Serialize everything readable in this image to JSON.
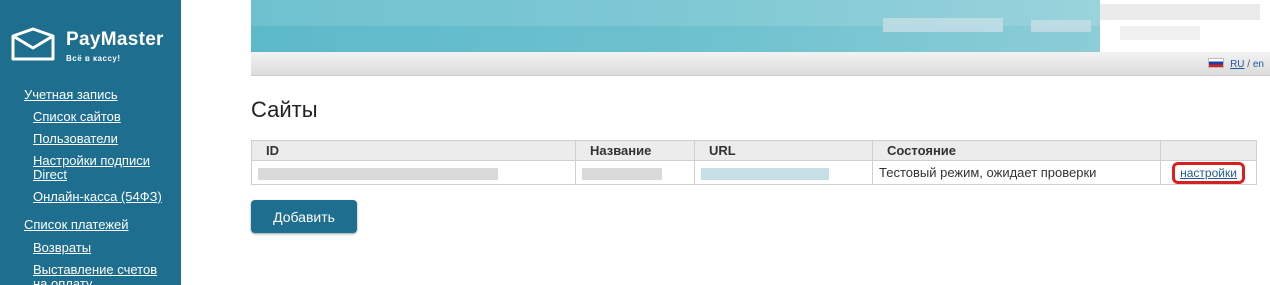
{
  "brand": {
    "title": "PayMaster",
    "tagline": "Всё в кассу!"
  },
  "sidebar": {
    "items": [
      {
        "label": "Учетная запись",
        "level": "top"
      },
      {
        "label": "Список сайтов",
        "level": "sub"
      },
      {
        "label": "Пользователи",
        "level": "sub"
      },
      {
        "label": "Настройки подписи Direct",
        "level": "sub"
      },
      {
        "label": "Онлайн-касса (54ФЗ)",
        "level": "sub"
      },
      {
        "label": "Список платежей",
        "level": "top"
      },
      {
        "label": "Возвраты",
        "level": "sub"
      },
      {
        "label": "Выставление счетов на оплату",
        "level": "sub"
      }
    ]
  },
  "header": {
    "lang_ru": "RU",
    "lang_sep": " / ",
    "lang_en": "en"
  },
  "main": {
    "title": "Сайты",
    "table": {
      "headers": [
        "ID",
        "Название",
        "URL",
        "Состояние",
        ""
      ],
      "rows": [
        {
          "status": "Тестовый режим, ожидает проверки",
          "action": "настройки"
        }
      ]
    },
    "add_button": "Добавить"
  },
  "colors": {
    "sidebar": "#1e6e8f",
    "highlight": "#d92020",
    "link": "#1e5a9a"
  }
}
